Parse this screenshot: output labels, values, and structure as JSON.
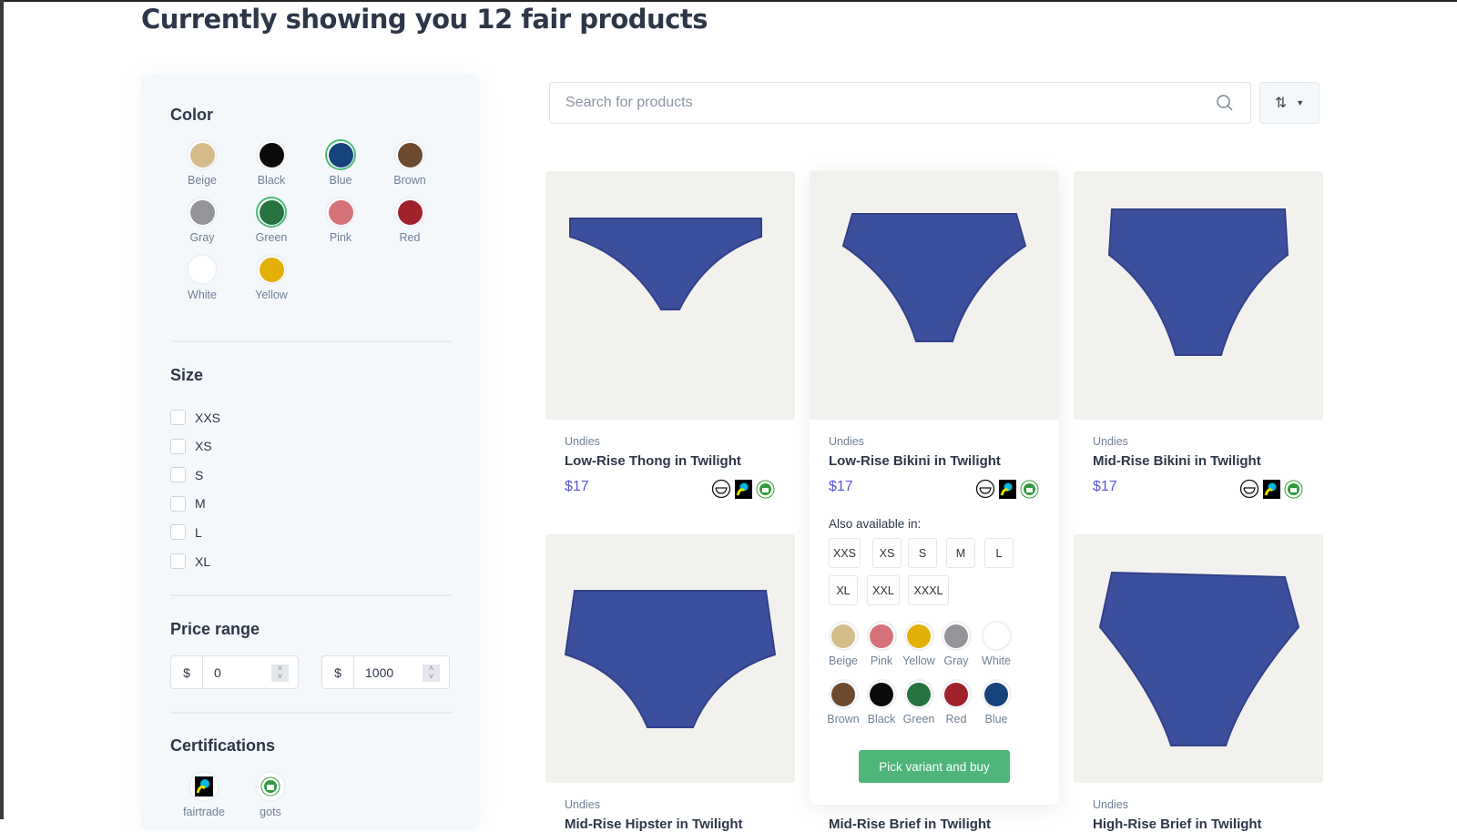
{
  "title": "Currently showing you 12 fair products",
  "filters": {
    "color_heading": "Color",
    "colors": [
      {
        "label": "Beige",
        "hex": "#d4bd8a",
        "selected": false
      },
      {
        "label": "Black",
        "hex": "#0b0b0b",
        "selected": false
      },
      {
        "label": "Blue",
        "hex": "#16437c",
        "selected": true
      },
      {
        "label": "Brown",
        "hex": "#6e4a2e",
        "selected": false
      },
      {
        "label": "Gray",
        "hex": "#939598",
        "selected": false
      },
      {
        "label": "Green",
        "hex": "#277340",
        "selected": true
      },
      {
        "label": "Pink",
        "hex": "#d57279",
        "selected": false
      },
      {
        "label": "Red",
        "hex": "#a0232c",
        "selected": false
      },
      {
        "label": "White",
        "hex": "#ffffff",
        "selected": false
      },
      {
        "label": "Yellow",
        "hex": "#e2b007",
        "selected": false
      }
    ],
    "size_heading": "Size",
    "sizes": [
      "XXS",
      "XS",
      "S",
      "M",
      "L",
      "XL"
    ],
    "price_heading": "Price range",
    "currency": "$",
    "price_min": "0",
    "price_max": "1000",
    "cert_heading": "Certifications",
    "certs": [
      {
        "label": "fairtrade",
        "icon": "fairtrade-icon"
      },
      {
        "label": "gots",
        "icon": "gots-icon"
      }
    ]
  },
  "search": {
    "placeholder": "Search for products",
    "icon": "search-icon"
  },
  "sort": {
    "icon": "sort-icon"
  },
  "products": [
    {
      "category": "Undies",
      "name": "Low-Rise Thong in Twilight",
      "price": "$17"
    },
    {
      "category": "Undies",
      "name": "Low-Rise Bikini in Twilight",
      "price": "$17"
    },
    {
      "category": "Undies",
      "name": "Mid-Rise Bikini in Twilight",
      "price": "$17"
    },
    {
      "category": "Undies",
      "name": "Mid-Rise Hipster in Twilight"
    },
    {
      "category": "",
      "name": "Mid-Rise Brief in Twilight"
    },
    {
      "category": "Undies",
      "name": "High-Rise Brief in Twilight"
    }
  ],
  "variant": {
    "also_label": "Also available in:",
    "sizes": [
      "XXS",
      "XS",
      "S",
      "M",
      "L",
      "XL",
      "XXL",
      "XXXL"
    ],
    "colors": [
      {
        "label": "Beige",
        "hex": "#d4bd8a"
      },
      {
        "label": "Pink",
        "hex": "#d57279"
      },
      {
        "label": "Yellow",
        "hex": "#e2b007"
      },
      {
        "label": "Gray",
        "hex": "#939598"
      },
      {
        "label": "White",
        "hex": "#ffffff"
      },
      {
        "label": "Brown",
        "hex": "#6e4a2e"
      },
      {
        "label": "Black",
        "hex": "#0b0b0b"
      },
      {
        "label": "Green",
        "hex": "#277340"
      },
      {
        "label": "Red",
        "hex": "#a0232c"
      },
      {
        "label": "Blue",
        "hex": "#16437c"
      }
    ],
    "buy_label": "Pick variant and buy"
  }
}
